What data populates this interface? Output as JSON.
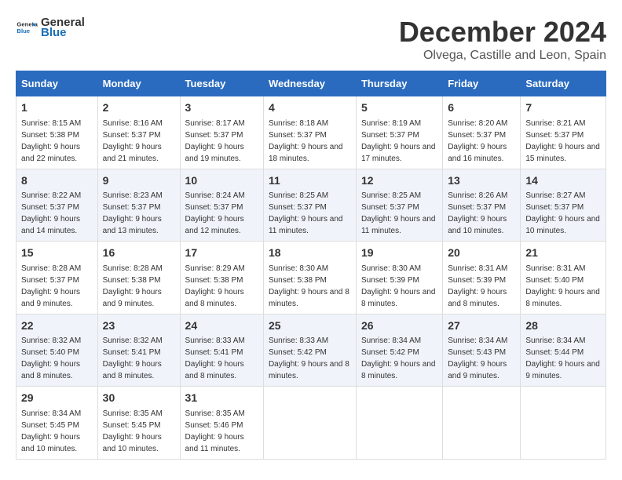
{
  "logo": {
    "general": "General",
    "blue": "Blue"
  },
  "title": "December 2024",
  "subtitle": "Olvega, Castille and Leon, Spain",
  "days_of_week": [
    "Sunday",
    "Monday",
    "Tuesday",
    "Wednesday",
    "Thursday",
    "Friday",
    "Saturday"
  ],
  "weeks": [
    [
      {
        "day": "1",
        "sunrise": "8:15 AM",
        "sunset": "5:38 PM",
        "daylight": "9 hours and 22 minutes."
      },
      {
        "day": "2",
        "sunrise": "8:16 AM",
        "sunset": "5:37 PM",
        "daylight": "9 hours and 21 minutes."
      },
      {
        "day": "3",
        "sunrise": "8:17 AM",
        "sunset": "5:37 PM",
        "daylight": "9 hours and 19 minutes."
      },
      {
        "day": "4",
        "sunrise": "8:18 AM",
        "sunset": "5:37 PM",
        "daylight": "9 hours and 18 minutes."
      },
      {
        "day": "5",
        "sunrise": "8:19 AM",
        "sunset": "5:37 PM",
        "daylight": "9 hours and 17 minutes."
      },
      {
        "day": "6",
        "sunrise": "8:20 AM",
        "sunset": "5:37 PM",
        "daylight": "9 hours and 16 minutes."
      },
      {
        "day": "7",
        "sunrise": "8:21 AM",
        "sunset": "5:37 PM",
        "daylight": "9 hours and 15 minutes."
      }
    ],
    [
      {
        "day": "8",
        "sunrise": "8:22 AM",
        "sunset": "5:37 PM",
        "daylight": "9 hours and 14 minutes."
      },
      {
        "day": "9",
        "sunrise": "8:23 AM",
        "sunset": "5:37 PM",
        "daylight": "9 hours and 13 minutes."
      },
      {
        "day": "10",
        "sunrise": "8:24 AM",
        "sunset": "5:37 PM",
        "daylight": "9 hours and 12 minutes."
      },
      {
        "day": "11",
        "sunrise": "8:25 AM",
        "sunset": "5:37 PM",
        "daylight": "9 hours and 11 minutes."
      },
      {
        "day": "12",
        "sunrise": "8:25 AM",
        "sunset": "5:37 PM",
        "daylight": "9 hours and 11 minutes."
      },
      {
        "day": "13",
        "sunrise": "8:26 AM",
        "sunset": "5:37 PM",
        "daylight": "9 hours and 10 minutes."
      },
      {
        "day": "14",
        "sunrise": "8:27 AM",
        "sunset": "5:37 PM",
        "daylight": "9 hours and 10 minutes."
      }
    ],
    [
      {
        "day": "15",
        "sunrise": "8:28 AM",
        "sunset": "5:37 PM",
        "daylight": "9 hours and 9 minutes."
      },
      {
        "day": "16",
        "sunrise": "8:28 AM",
        "sunset": "5:38 PM",
        "daylight": "9 hours and 9 minutes."
      },
      {
        "day": "17",
        "sunrise": "8:29 AM",
        "sunset": "5:38 PM",
        "daylight": "9 hours and 8 minutes."
      },
      {
        "day": "18",
        "sunrise": "8:30 AM",
        "sunset": "5:38 PM",
        "daylight": "9 hours and 8 minutes."
      },
      {
        "day": "19",
        "sunrise": "8:30 AM",
        "sunset": "5:39 PM",
        "daylight": "9 hours and 8 minutes."
      },
      {
        "day": "20",
        "sunrise": "8:31 AM",
        "sunset": "5:39 PM",
        "daylight": "9 hours and 8 minutes."
      },
      {
        "day": "21",
        "sunrise": "8:31 AM",
        "sunset": "5:40 PM",
        "daylight": "9 hours and 8 minutes."
      }
    ],
    [
      {
        "day": "22",
        "sunrise": "8:32 AM",
        "sunset": "5:40 PM",
        "daylight": "9 hours and 8 minutes."
      },
      {
        "day": "23",
        "sunrise": "8:32 AM",
        "sunset": "5:41 PM",
        "daylight": "9 hours and 8 minutes."
      },
      {
        "day": "24",
        "sunrise": "8:33 AM",
        "sunset": "5:41 PM",
        "daylight": "9 hours and 8 minutes."
      },
      {
        "day": "25",
        "sunrise": "8:33 AM",
        "sunset": "5:42 PM",
        "daylight": "9 hours and 8 minutes."
      },
      {
        "day": "26",
        "sunrise": "8:34 AM",
        "sunset": "5:42 PM",
        "daylight": "9 hours and 8 minutes."
      },
      {
        "day": "27",
        "sunrise": "8:34 AM",
        "sunset": "5:43 PM",
        "daylight": "9 hours and 9 minutes."
      },
      {
        "day": "28",
        "sunrise": "8:34 AM",
        "sunset": "5:44 PM",
        "daylight": "9 hours and 9 minutes."
      }
    ],
    [
      {
        "day": "29",
        "sunrise": "8:34 AM",
        "sunset": "5:45 PM",
        "daylight": "9 hours and 10 minutes."
      },
      {
        "day": "30",
        "sunrise": "8:35 AM",
        "sunset": "5:45 PM",
        "daylight": "9 hours and 10 minutes."
      },
      {
        "day": "31",
        "sunrise": "8:35 AM",
        "sunset": "5:46 PM",
        "daylight": "9 hours and 11 minutes."
      },
      null,
      null,
      null,
      null
    ]
  ],
  "labels": {
    "sunrise": "Sunrise:",
    "sunset": "Sunset:",
    "daylight": "Daylight:"
  }
}
